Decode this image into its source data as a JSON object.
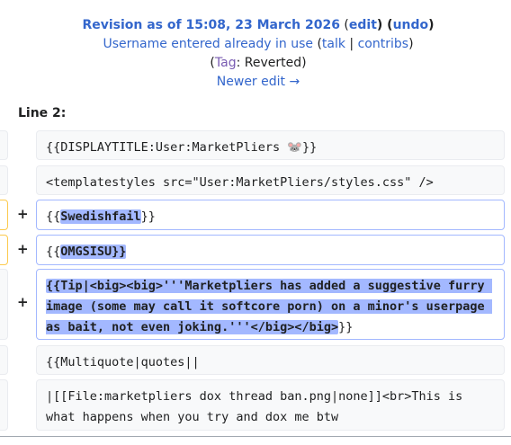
{
  "revision": {
    "title_prefix": "Revision as of 15:08, 23 March 2026",
    "edit_link": "edit",
    "undo_link": "undo",
    "user": "Username entered already in use",
    "talk_link": "talk",
    "contribs_link": "contribs",
    "tag_label": "Tag",
    "tag_value": ": Reverted",
    "newer_edit": "Newer edit →"
  },
  "diff": {
    "line_label": "Line 2:",
    "rows": [
      {
        "type": "context",
        "text": "{{DISPLAYTITLE:User:MarketPliers 🐭}}"
      },
      {
        "type": "context",
        "text": "<templatestyles src=\"User:MarketPliers/styles.css\" />"
      },
      {
        "type": "added",
        "marker": "+",
        "pre": "{{",
        "hl": "Swedishfail",
        "post": "}}"
      },
      {
        "type": "added",
        "marker": "+",
        "pre": "{{",
        "hl": "OMGSISU}}",
        "post": ""
      },
      {
        "type": "added",
        "marker": "+",
        "pre": "",
        "hl": "{{Tip|<big><big>'''Marketpliers has added a suggestive furry image (some may call it softcore porn) on a minor's userpage as bait, not even joking.'''</big></big>",
        "post": "}}"
      },
      {
        "type": "context",
        "text": "{{Multiquote|quotes||"
      },
      {
        "type": "context",
        "text": "|[[File:marketpliers dox thread ban.png|none]]<br>This is what happens when you try and dox me btw"
      }
    ]
  }
}
